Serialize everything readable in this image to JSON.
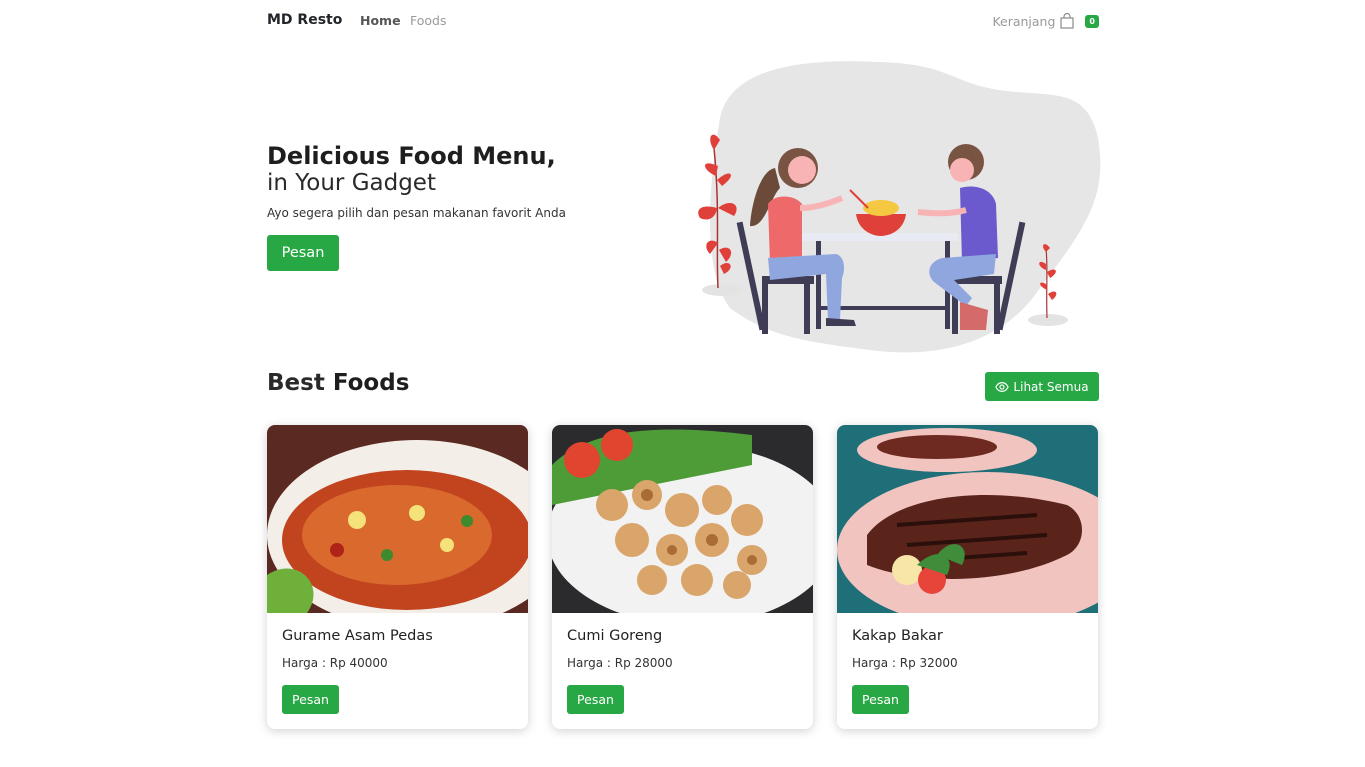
{
  "navbar": {
    "brand": "MD Resto",
    "links": [
      {
        "label": "Home",
        "active": true
      },
      {
        "label": "Foods",
        "active": false
      }
    ],
    "cart": {
      "label": "Keranjang",
      "icon": "shopping-bag-icon",
      "count": "0"
    }
  },
  "hero": {
    "title": "Delicious Food Menu,",
    "subtitle": "in Your Gadget",
    "description": "Ayo segera pilih dan pesan makanan favorit Anda",
    "button_label": "Pesan",
    "illustration": "couple-dining-illustration"
  },
  "best_foods": {
    "title_prefix": "Best",
    "title_bold": "Foods",
    "see_all_label": "Lihat Semua",
    "see_all_icon": "eye-icon",
    "items": [
      {
        "name": "Gurame Asam Pedas",
        "price": "Harga : Rp 40000",
        "button_label": "Pesan",
        "image": "gurame-asam-pedas-photo"
      },
      {
        "name": "Cumi Goreng",
        "price": "Harga : Rp 28000",
        "button_label": "Pesan",
        "image": "cumi-goreng-photo"
      },
      {
        "name": "Kakap Bakar",
        "price": "Harga : Rp 32000",
        "button_label": "Pesan",
        "image": "kakap-bakar-photo"
      }
    ]
  },
  "colors": {
    "accent": "#28a745",
    "illustration_red": "#e0403a",
    "blob": "#e6e6e6"
  }
}
